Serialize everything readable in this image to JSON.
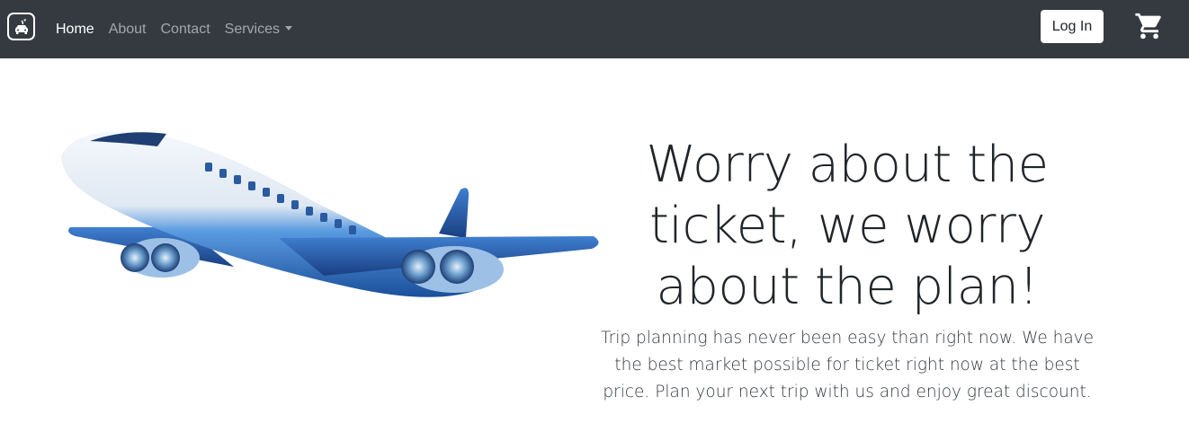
{
  "navbar": {
    "brand_icon": "car-logo-icon",
    "links": [
      {
        "label": "Home",
        "active": true
      },
      {
        "label": "About",
        "active": false
      },
      {
        "label": "Contact",
        "active": false
      },
      {
        "label": "Services",
        "active": false,
        "dropdown": true
      }
    ],
    "login_label": "Log In",
    "cart_icon": "shopping-cart-icon"
  },
  "hero": {
    "image_icon": "airplane-illustration",
    "title": "Worry about the ticket, we worry about the plan!",
    "description": "Trip planning has never been easy than right now. We have the best market possible for ticket right now at the best price. Plan your next trip with us and enjoy great discount."
  },
  "colors": {
    "navbar_bg": "#343a40",
    "nav_active": "#ffffff",
    "nav_inactive": "rgba(255,255,255,0.55)",
    "plane_blue": "#2f6fc4"
  }
}
